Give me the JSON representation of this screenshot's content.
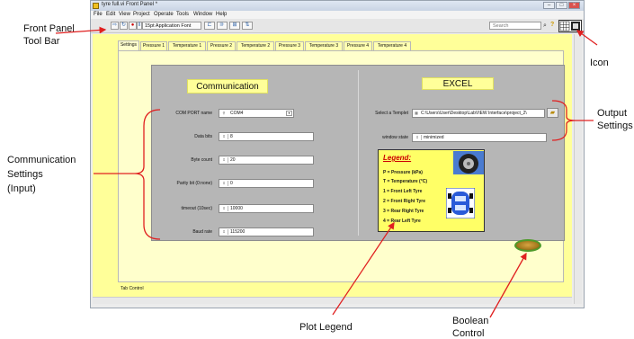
{
  "window": {
    "title": "tyre full.vi Front Panel *",
    "controls": [
      "–",
      "□",
      "×"
    ]
  },
  "menu": [
    "File",
    "Edit",
    "View",
    "Project",
    "Operate",
    "Tools",
    "Window",
    "Help"
  ],
  "toolbar": {
    "font": "15pt Application Font",
    "search_placeholder": "Search",
    "icon": "connector-pane-icon"
  },
  "tabs": [
    "Settings",
    "Pressure 1",
    "Temperature 1",
    "Pressure 2",
    "Temperature 2",
    "Pressure 3",
    "Temperature 3",
    "Pressure 4",
    "Temperature 4"
  ],
  "tab_control_label": "Tab Control",
  "communication": {
    "header": "Communication",
    "fields": [
      {
        "label": "COM PORT name",
        "value": "COM4"
      },
      {
        "label": "Data bits",
        "value": "8"
      },
      {
        "label": "Byte count",
        "value": "20"
      },
      {
        "label": "Parity bit (0:none)",
        "value": "0"
      },
      {
        "label": "timeout (10sec)",
        "value": "10000"
      },
      {
        "label": "Baud rate",
        "value": "115200"
      }
    ]
  },
  "excel": {
    "header": "EXCEL",
    "template_label": "Select a Templet",
    "template_value": "C:\\Users\\User\\Desktop\\LabVIEW Interface\\project_2\\",
    "window_state_label": "window state",
    "window_state_value": "minimized"
  },
  "legend": {
    "title": "Legend:",
    "lines": [
      "P = Pressure (kPa)",
      "T = Temperature (°C)",
      "1 = Front Left Tyre",
      "2 = Front Right Tyre",
      "3 = Rear Right Tyre",
      "4 = Rear Left Tyre"
    ]
  },
  "annotations": {
    "toolbar": [
      "Front Panel",
      "Tool Bar"
    ],
    "icon": "Icon",
    "output": [
      "Output",
      "Settings"
    ],
    "communication": [
      "Communication",
      "Settings",
      "(Input)"
    ],
    "plot_legend": "Plot Legend",
    "boolean": [
      "Boolean",
      "Control"
    ]
  },
  "colors": {
    "panel": "#ffff99",
    "tab_page": "#ffffcc",
    "gray_frame": "#b6b6b6",
    "legend_bg": "#ffff66",
    "annotation_arrow": "#e02020"
  }
}
